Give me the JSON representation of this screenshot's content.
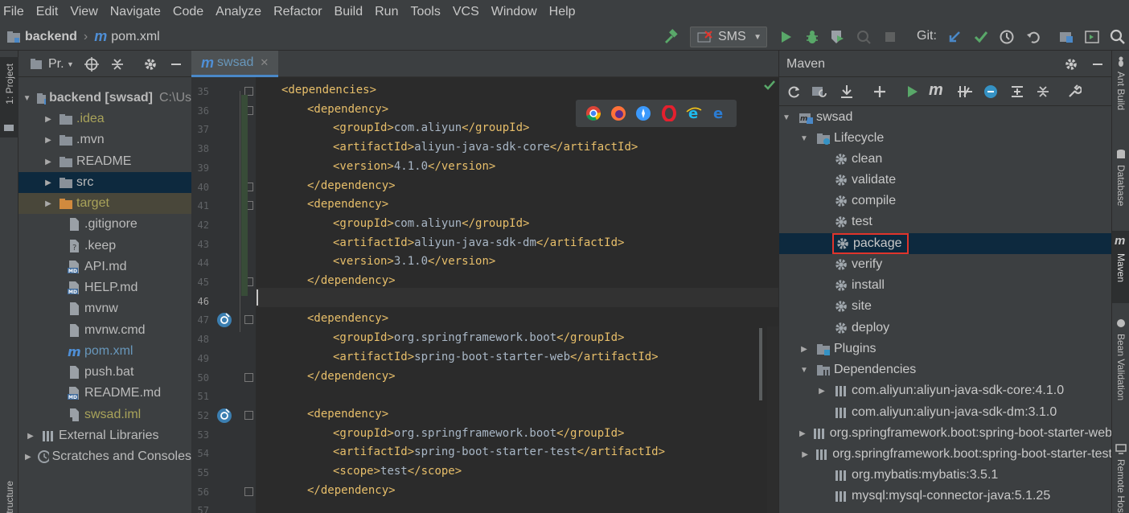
{
  "menu": [
    "File",
    "Edit",
    "View",
    "Navigate",
    "Code",
    "Analyze",
    "Refactor",
    "Build",
    "Run",
    "Tools",
    "VCS",
    "Window",
    "Help"
  ],
  "nav": {
    "project": "backend",
    "file": "pom.xml",
    "run_config": "SMS",
    "git_label": "Git:"
  },
  "project_panel": {
    "tab_label": "1: Project",
    "bottom_tab": "Structure",
    "selector": "Pr.",
    "items": [
      {
        "label": "backend [swsad]",
        "suffix": "C:\\Us",
        "indent": 0,
        "open": true,
        "icon": "module-folder-icon",
        "color": "#bbbbbb",
        "bold": true
      },
      {
        "label": ".idea",
        "indent": 1,
        "open": false,
        "icon": "folder-icon",
        "color": "#a9a35a"
      },
      {
        "label": ".mvn",
        "indent": 1,
        "open": false,
        "icon": "folder-icon",
        "color": "#bbbbbb"
      },
      {
        "label": "README",
        "indent": 1,
        "open": false,
        "icon": "folder-icon",
        "color": "#bbbbbb"
      },
      {
        "label": "src",
        "indent": 1,
        "open": false,
        "icon": "folder-icon",
        "color": "#bbbbbb",
        "selected": true
      },
      {
        "label": "target",
        "indent": 1,
        "open": false,
        "icon": "orange-folder-icon",
        "color": "#a9a35a",
        "highlight": true
      },
      {
        "label": ".gitignore",
        "indent": 2,
        "icon": "file-icon",
        "color": "#bbbbbb"
      },
      {
        "label": ".keep",
        "indent": 2,
        "icon": "unknown-file-icon",
        "color": "#bbbbbb"
      },
      {
        "label": "API.md",
        "indent": 2,
        "icon": "md-file-icon",
        "color": "#bbbbbb"
      },
      {
        "label": "HELP.md",
        "indent": 2,
        "icon": "md-file-icon",
        "color": "#bbbbbb"
      },
      {
        "label": "mvnw",
        "indent": 2,
        "icon": "file-icon",
        "color": "#bbbbbb"
      },
      {
        "label": "mvnw.cmd",
        "indent": 2,
        "icon": "file-icon",
        "color": "#bbbbbb"
      },
      {
        "label": "pom.xml",
        "indent": 2,
        "icon": "maven-file-icon",
        "color": "#6897bb"
      },
      {
        "label": "push.bat",
        "indent": 2,
        "icon": "file-icon",
        "color": "#bbbbbb"
      },
      {
        "label": "README.md",
        "indent": 2,
        "icon": "md-file-icon",
        "color": "#bbbbbb"
      },
      {
        "label": "swsad.iml",
        "indent": 2,
        "icon": "iml-file-icon",
        "color": "#a9a35a"
      },
      {
        "label": "External Libraries",
        "indent": 0,
        "open": false,
        "icon": "library-icon",
        "color": "#bbbbbb"
      },
      {
        "label": "Scratches and Consoles",
        "indent": 0,
        "open": false,
        "icon": "scratches-icon",
        "color": "#bbbbbb"
      }
    ]
  },
  "editor": {
    "tab": "swsad",
    "lines": [
      {
        "n": "35",
        "indent": 1,
        "parts": [
          [
            "tag",
            "<dependencies>"
          ]
        ]
      },
      {
        "n": "36",
        "indent": 2,
        "parts": [
          [
            "tag",
            "<dependency>"
          ]
        ]
      },
      {
        "n": "37",
        "indent": 3,
        "parts": [
          [
            "tag",
            "<groupId>"
          ],
          [
            "txt",
            "com.aliyun"
          ],
          [
            "tag",
            "</groupId>"
          ]
        ]
      },
      {
        "n": "38",
        "indent": 3,
        "parts": [
          [
            "tag",
            "<artifactId>"
          ],
          [
            "txt",
            "aliyun-java-sdk-core"
          ],
          [
            "tag",
            "</artifactId>"
          ]
        ]
      },
      {
        "n": "39",
        "indent": 3,
        "parts": [
          [
            "tag",
            "<version>"
          ],
          [
            "txt",
            "4.1.0"
          ],
          [
            "tag",
            "</version>"
          ]
        ]
      },
      {
        "n": "40",
        "indent": 2,
        "parts": [
          [
            "tag",
            "</dependency>"
          ]
        ]
      },
      {
        "n": "41",
        "indent": 2,
        "parts": [
          [
            "tag",
            "<dependency>"
          ]
        ]
      },
      {
        "n": "42",
        "indent": 3,
        "parts": [
          [
            "tag",
            "<groupId>"
          ],
          [
            "txt",
            "com.aliyun"
          ],
          [
            "tag",
            "</groupId>"
          ]
        ]
      },
      {
        "n": "43",
        "indent": 3,
        "parts": [
          [
            "tag",
            "<artifactId>"
          ],
          [
            "txt",
            "aliyun-java-sdk-dm"
          ],
          [
            "tag",
            "</artifactId>"
          ]
        ]
      },
      {
        "n": "44",
        "indent": 3,
        "parts": [
          [
            "tag",
            "<version>"
          ],
          [
            "txt",
            "3.1.0"
          ],
          [
            "tag",
            "</version>"
          ]
        ]
      },
      {
        "n": "45",
        "indent": 2,
        "parts": [
          [
            "tag",
            "</dependency>"
          ]
        ]
      },
      {
        "n": "46",
        "indent": 0,
        "parts": []
      },
      {
        "n": "47",
        "indent": 2,
        "parts": [
          [
            "tag",
            "<dependency>"
          ]
        ]
      },
      {
        "n": "48",
        "indent": 3,
        "parts": [
          [
            "tag",
            "<groupId>"
          ],
          [
            "txt",
            "org.springframework.boot"
          ],
          [
            "tag",
            "</groupId>"
          ]
        ]
      },
      {
        "n": "49",
        "indent": 3,
        "parts": [
          [
            "tag",
            "<artifactId>"
          ],
          [
            "txt",
            "spring-boot-starter-web"
          ],
          [
            "tag",
            "</artifactId>"
          ]
        ]
      },
      {
        "n": "50",
        "indent": 2,
        "parts": [
          [
            "tag",
            "</dependency>"
          ]
        ]
      },
      {
        "n": "51",
        "indent": 0,
        "parts": []
      },
      {
        "n": "52",
        "indent": 2,
        "parts": [
          [
            "tag",
            "<dependency>"
          ]
        ]
      },
      {
        "n": "53",
        "indent": 3,
        "parts": [
          [
            "tag",
            "<groupId>"
          ],
          [
            "txt",
            "org.springframework.boot"
          ],
          [
            "tag",
            "</groupId>"
          ]
        ]
      },
      {
        "n": "54",
        "indent": 3,
        "parts": [
          [
            "tag",
            "<artifactId>"
          ],
          [
            "txt",
            "spring-boot-starter-test"
          ],
          [
            "tag",
            "</artifactId>"
          ]
        ]
      },
      {
        "n": "55",
        "indent": 3,
        "parts": [
          [
            "tag",
            "<scope>"
          ],
          [
            "txt",
            "test"
          ],
          [
            "tag",
            "</scope>"
          ]
        ]
      },
      {
        "n": "56",
        "indent": 2,
        "parts": [
          [
            "tag",
            "</dependency>"
          ]
        ]
      },
      {
        "n": "57",
        "indent": 0,
        "parts": []
      }
    ]
  },
  "maven": {
    "title": "Maven",
    "items": [
      {
        "label": "swsad",
        "indent": 0,
        "arrow": "open",
        "icon": "maven-project-icon"
      },
      {
        "label": "Lifecycle",
        "indent": 1,
        "arrow": "open",
        "icon": "lifecycle-folder-icon"
      },
      {
        "label": "clean",
        "indent": 2,
        "icon": "gear-icon"
      },
      {
        "label": "validate",
        "indent": 2,
        "icon": "gear-icon"
      },
      {
        "label": "compile",
        "indent": 2,
        "icon": "gear-icon"
      },
      {
        "label": "test",
        "indent": 2,
        "icon": "gear-icon"
      },
      {
        "label": "package",
        "indent": 2,
        "icon": "gear-icon",
        "selected": true
      },
      {
        "label": "verify",
        "indent": 2,
        "icon": "gear-icon"
      },
      {
        "label": "install",
        "indent": 2,
        "icon": "gear-icon"
      },
      {
        "label": "site",
        "indent": 2,
        "icon": "gear-icon"
      },
      {
        "label": "deploy",
        "indent": 2,
        "icon": "gear-icon"
      },
      {
        "label": "Plugins",
        "indent": 1,
        "arrow": "closed",
        "icon": "plugins-folder-icon"
      },
      {
        "label": "Dependencies",
        "indent": 1,
        "arrow": "open",
        "icon": "dependencies-folder-icon"
      },
      {
        "label": "com.aliyun:aliyun-java-sdk-core:4.1.0",
        "indent": 2,
        "arrow": "closed",
        "icon": "library-icon"
      },
      {
        "label": "com.aliyun:aliyun-java-sdk-dm:3.1.0",
        "indent": 2,
        "icon": "library-icon"
      },
      {
        "label": "org.springframework.boot:spring-boot-starter-web",
        "indent": 2,
        "arrow": "closed",
        "icon": "library-icon"
      },
      {
        "label": "org.springframework.boot:spring-boot-starter-test",
        "indent": 2,
        "arrow": "closed",
        "icon": "library-icon"
      },
      {
        "label": "org.mybatis:mybatis:3.5.1",
        "indent": 2,
        "icon": "library-icon"
      },
      {
        "label": "mysql:mysql-connector-java:5.1.25",
        "indent": 2,
        "icon": "library-icon"
      }
    ]
  },
  "right_tabs": [
    "Ant Build",
    "Database",
    "Maven",
    "Bean Validation",
    "Remote Host"
  ],
  "colors": {
    "accent": "#6897bb",
    "green": "#59a869",
    "selection": "#0d293e",
    "highlight_box": "#e0342b"
  }
}
